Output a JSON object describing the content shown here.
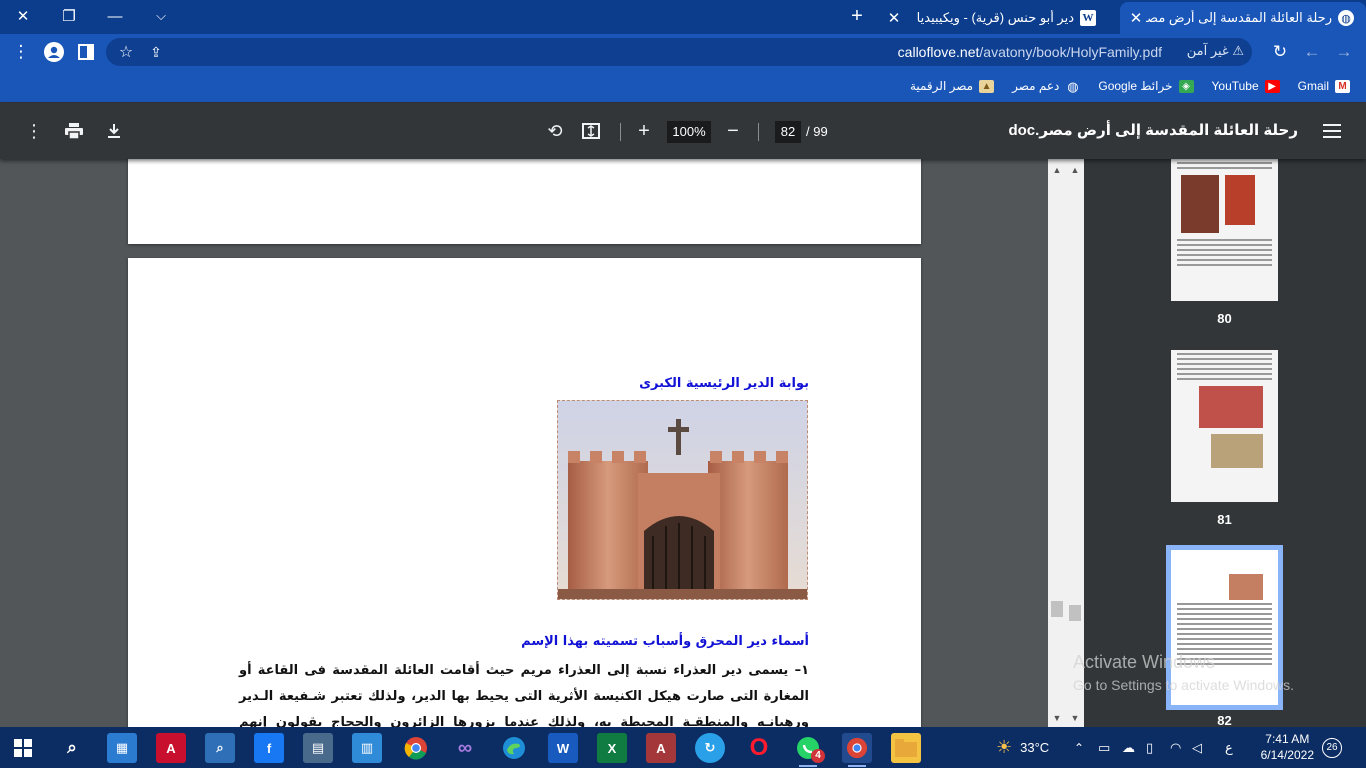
{
  "tabs": [
    {
      "title": "رحلة العائلة المقدسة إلى أرض مصر",
      "icon": "globe-icon",
      "active": true
    },
    {
      "title": "دير أبو حنس (قرية) - ويكيبيديا",
      "icon": "wikipedia-icon",
      "active": false
    }
  ],
  "address": {
    "security_label": "غير آمن",
    "url_host": "calloflove.net",
    "url_path": "/avatony/book/HolyFamily.pdf"
  },
  "bookmarks": [
    {
      "label": "Gmail",
      "icon": "gmail-icon",
      "color": "#d93025"
    },
    {
      "label": "YouTube",
      "icon": "youtube-icon",
      "color": "#ff0000"
    },
    {
      "label": "خرائط Google",
      "icon": "maps-icon",
      "color": "#34a853"
    },
    {
      "label": "دعم مصر",
      "icon": "globe-icon",
      "color": "#ffffff"
    },
    {
      "label": "مصر الرقمية",
      "icon": "digital-egypt-icon",
      "color": "#e8d39a"
    }
  ],
  "pdf": {
    "title": "رحلة العائلة المقدسة إلى أرض مصر.doc",
    "current_page": "82",
    "total_pages": "/ 99",
    "zoom": "100%"
  },
  "page": {
    "caption_gate": "بوابة الدير الرئيسية الكبرى",
    "heading_names": "أسماء دير المحرق وأسباب تسميته بهذا الإسم",
    "paragraph": "١– يسمى دير العذراء نسبة إلى العذراء مريم حيث أقامت العائلة المقدسة فى القاعة أو المغارة التى صارت هيكل الكنيسة الأثرية التى يحيط بها الدير، ولذلك تعتبر شـفيعة الـدير ورهبانـه والمنطقـة المحيطة به، ولذلك عندما يزورها الزائرون والحجاج يقولون إنهم ذاهبون إلى العذراء"
  },
  "thumbnails": [
    {
      "number": "80",
      "selected": false
    },
    {
      "number": "81",
      "selected": false
    },
    {
      "number": "82",
      "selected": true
    }
  ],
  "watermark": {
    "line1": "Activate Windows",
    "line2": "Go to Settings to activate Windows."
  },
  "taskbar": {
    "apps": [
      "windows-start-icon",
      "search-icon",
      "calculator-app-icon",
      "autocad-icon",
      "magnifier-icon",
      "facebook-icon",
      "calculator-icon",
      "calendar-icon",
      "chrome-icon",
      "visual-studio-icon",
      "edge-icon",
      "word-icon",
      "excel-icon",
      "access-icon",
      "sync-icon",
      "opera-icon",
      "whatsapp-icon",
      "chrome-profile-icon",
      "file-explorer-icon"
    ],
    "whatsapp_badge": "4",
    "temperature": "33°C",
    "lang": "ع",
    "time": "7:41 AM",
    "date": "6/14/2022",
    "notifications": "26"
  }
}
